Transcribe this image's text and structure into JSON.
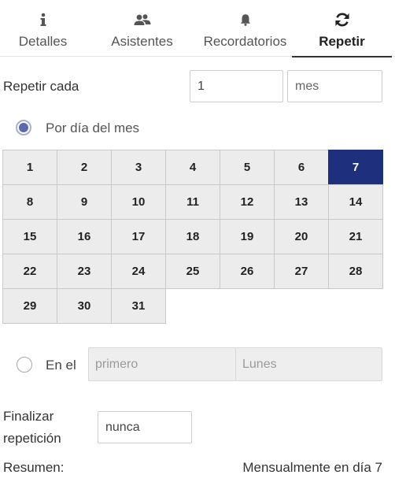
{
  "tabs": [
    {
      "label": "Detalles",
      "icon": "info-icon",
      "active": false
    },
    {
      "label": "Asistentes",
      "icon": "users-icon",
      "active": false
    },
    {
      "label": "Recordatorios",
      "icon": "bell-icon",
      "active": false
    },
    {
      "label": "Repetir",
      "icon": "refresh-icon",
      "active": true
    }
  ],
  "repeat": {
    "label": "Repetir cada",
    "interval_value": "1",
    "unit_value": "mes"
  },
  "by_day_of_month": {
    "label": "Por día del mes",
    "checked": true,
    "days": [
      "1",
      "2",
      "3",
      "4",
      "5",
      "6",
      "7",
      "8",
      "9",
      "10",
      "11",
      "12",
      "13",
      "14",
      "15",
      "16",
      "17",
      "18",
      "19",
      "20",
      "21",
      "22",
      "23",
      "24",
      "25",
      "26",
      "27",
      "28",
      "29",
      "30",
      "31"
    ],
    "selected_day": "7"
  },
  "on_the": {
    "label": "En el",
    "checked": false,
    "ordinal_value": "primero",
    "weekday_value": "Lunes"
  },
  "end": {
    "label_line1": "Finalizar",
    "label_line2": "repetición",
    "value": "nunca"
  },
  "summary": {
    "label": "Resumen:",
    "text": "Mensualmente en día 7"
  },
  "colors": {
    "selected_day_bg": "#1e2f7d",
    "radio_dot": "#5a69b0"
  }
}
